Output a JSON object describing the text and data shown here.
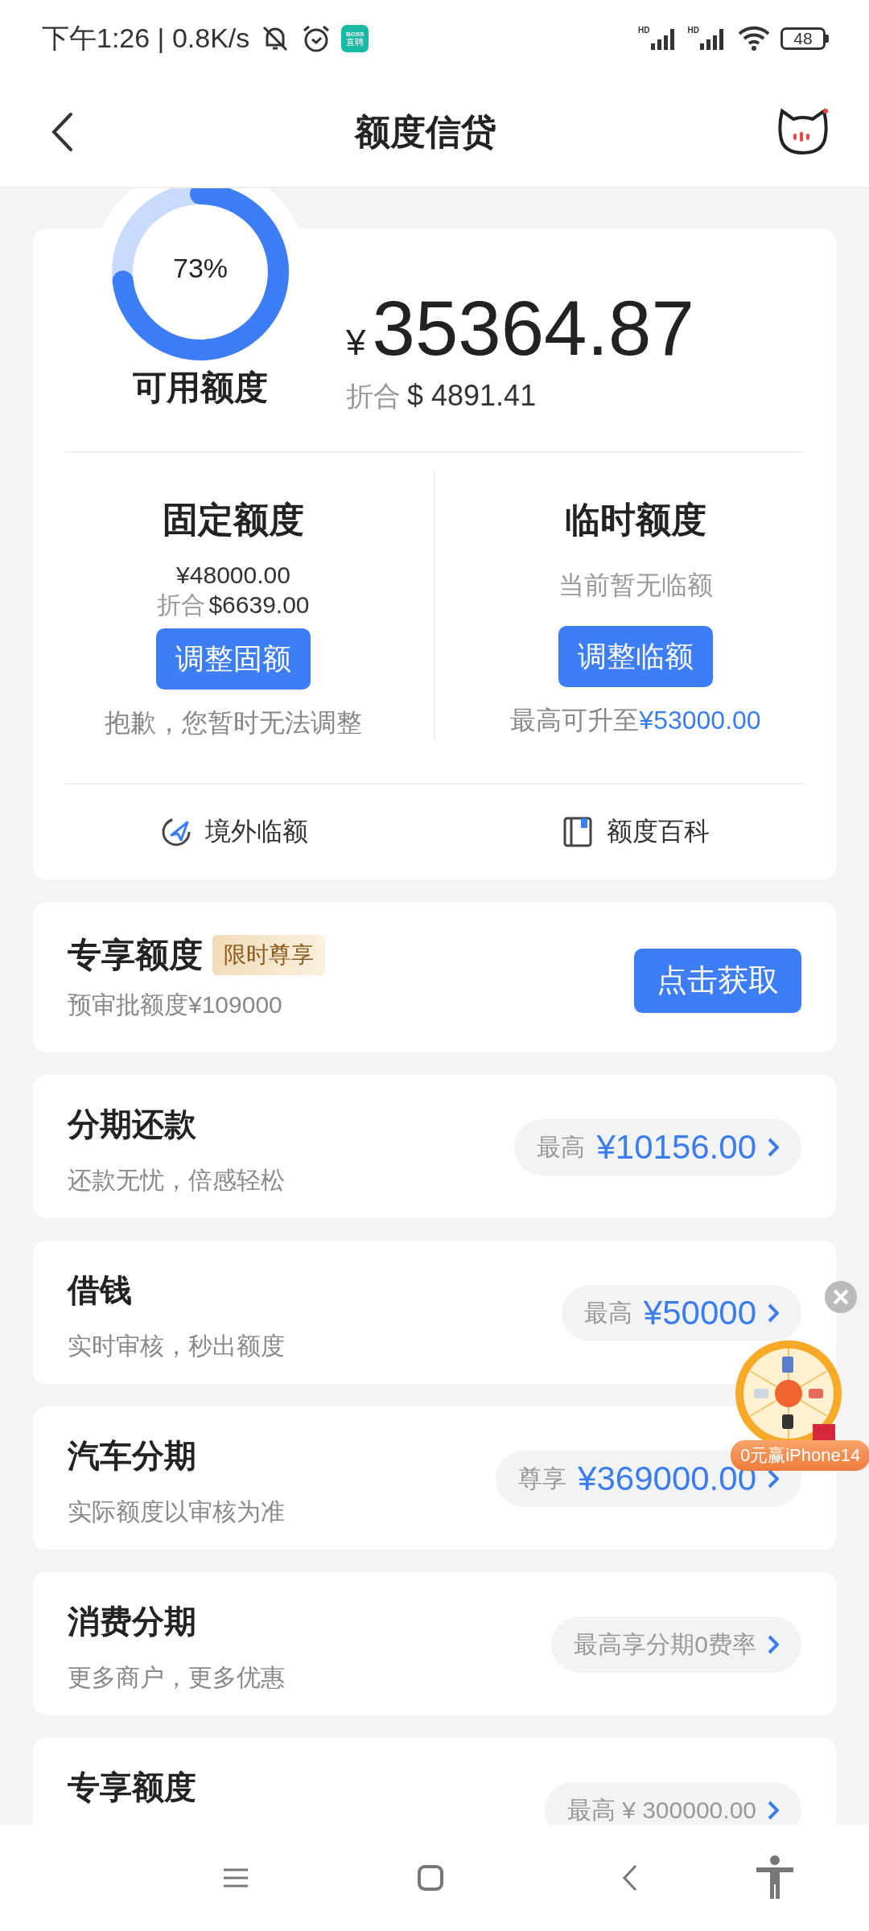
{
  "status_bar": {
    "time": "下午1:26 | 0.8K/s",
    "app_badge": [
      "BOSS",
      "直聘"
    ],
    "signal_labels": [
      "HD",
      "HD"
    ],
    "battery": "48"
  },
  "header": {
    "title": "额度信贷"
  },
  "credit_summary": {
    "ring": {
      "label": "73%",
      "level": 0.73
    },
    "available_label": "可用额度",
    "currency": "¥",
    "amount": "35364.87",
    "converted_prefix": "折合",
    "converted_amount": "$ 4891.41",
    "limits": [
      {
        "title": "固定额度",
        "amount": "¥48000.00",
        "converted_prefix": "折合",
        "converted_amount": "$6639.00",
        "button": "调整固额",
        "note": "抱歉，您暂时无法调整"
      },
      {
        "title": "临时额度",
        "status": "当前暂无临额",
        "button": "调整临额",
        "note": "最高可升至",
        "note_amount": "¥53000.00"
      }
    ],
    "links": [
      {
        "label": "境外临额"
      },
      {
        "label": "额度百科"
      }
    ]
  },
  "exclusive": {
    "title": "专享额度",
    "tag": "限时尊享",
    "subtitle": "预审批额度¥109000",
    "button": "点击获取"
  },
  "products": [
    {
      "title": "分期还款",
      "subtitle": "还款无忧，倍感轻松",
      "pill_label": "最高",
      "pill_value": "¥10156.00"
    },
    {
      "title": "借钱",
      "subtitle": "实时审核，秒出额度",
      "pill_label": "最高",
      "pill_value": "¥50000"
    },
    {
      "title": "汽车分期",
      "subtitle": "实际额度以审核为准",
      "pill_label": "尊享",
      "pill_value": "¥369000.00"
    },
    {
      "title": "消费分期",
      "subtitle": "更多商户，更多优惠",
      "pill_label": "最高享分期0费率"
    },
    {
      "title": "专享额度",
      "pill_label": "最高 ¥ 300000.00"
    }
  ],
  "float_promo": {
    "label": "0元赢iPhone14"
  }
}
